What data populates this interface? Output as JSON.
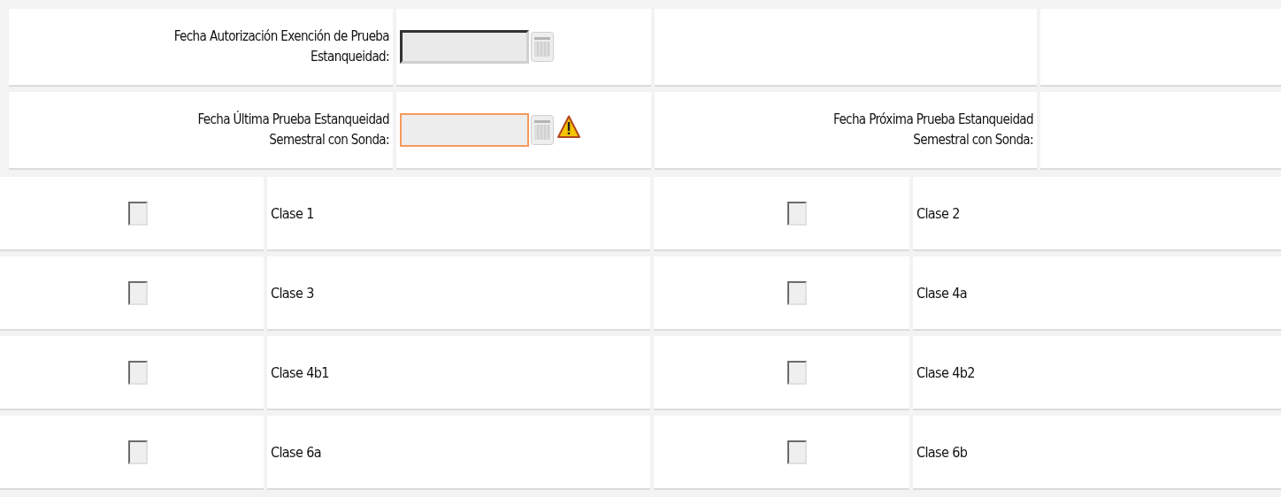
{
  "date_rows": [
    {
      "cells": [
        {
          "label_lines": [
            "Fecha Autorización Exención de Prueba",
            "Estanqueidad:"
          ],
          "field": {
            "invalid": false
          }
        },
        {}
      ]
    },
    {
      "cells": [
        {
          "label_lines": [
            "Fecha Última Prueba Estanqueidad",
            "Semestral con Sonda:"
          ],
          "field": {
            "invalid": true
          }
        },
        {
          "label_lines": [
            "Fecha Próxima Prueba Estanqueidad",
            "Semestral con Sonda:"
          ]
        }
      ]
    }
  ],
  "classes": [
    {
      "label": "Clase 1",
      "checked": false
    },
    {
      "label": "Clase 2",
      "checked": false
    },
    {
      "label": "Clase 3",
      "checked": false
    },
    {
      "label": "Clase 4a",
      "checked": false
    },
    {
      "label": "Clase 4b1",
      "checked": false
    },
    {
      "label": "Clase 4b2",
      "checked": false
    },
    {
      "label": "Clase 6a",
      "checked": false
    },
    {
      "label": "Clase 6b",
      "checked": false
    }
  ]
}
